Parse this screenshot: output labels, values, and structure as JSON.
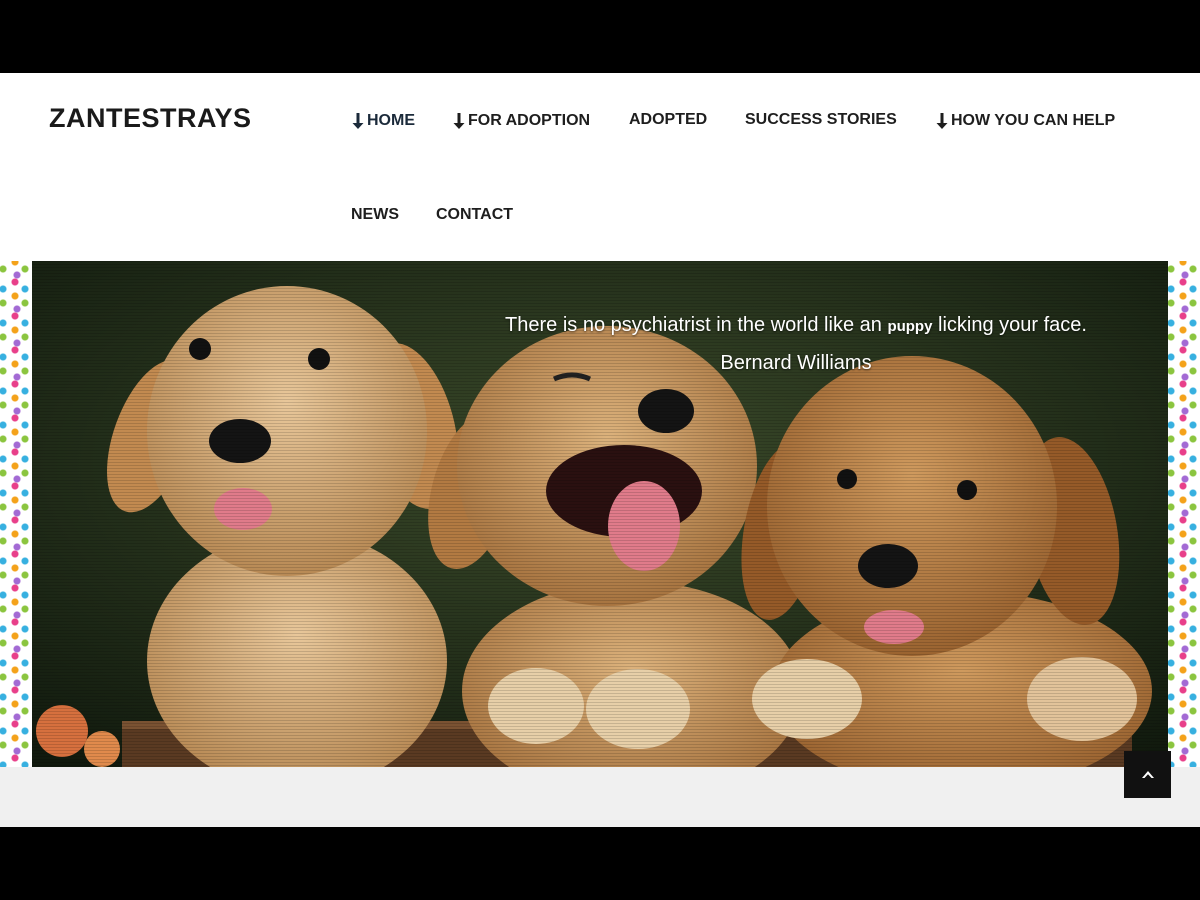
{
  "site": {
    "logo": "ZANTESTRAYS"
  },
  "nav": {
    "items": [
      {
        "label": "HOME",
        "has_dropdown": true,
        "active": true
      },
      {
        "label": "FOR ADOPTION",
        "has_dropdown": true
      },
      {
        "label": "ADOPTED",
        "has_dropdown": false
      },
      {
        "label": "SUCCESS STORIES",
        "has_dropdown": false
      },
      {
        "label": "HOW YOU CAN HELP",
        "has_dropdown": true
      },
      {
        "label": "NEWS",
        "has_dropdown": false
      },
      {
        "label": "CONTACT",
        "has_dropdown": false
      }
    ]
  },
  "hero": {
    "quote_before": "There is no psychiatrist in the world like an ",
    "quote_emphasis": "puppy",
    "quote_after": " licking your face.",
    "author": "Bernard Williams",
    "image_subject": "three golden retriever puppies"
  },
  "icons": {
    "dropdown": "arrow-down-icon",
    "scroll_top": "chevron-up-icon"
  },
  "colors": {
    "text": "#1e1e1e",
    "band": "#f0f0f0",
    "button": "#111111",
    "frame": "#000000"
  }
}
